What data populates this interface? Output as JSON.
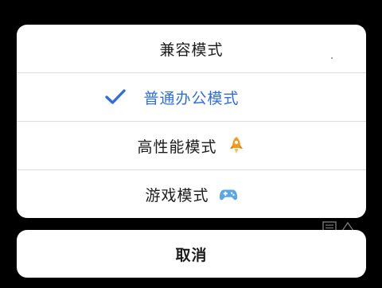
{
  "dialog": {
    "options": [
      {
        "label": "兼容模式",
        "selected": false,
        "icon": ""
      },
      {
        "label": "普通办公模式",
        "selected": true,
        "icon": "checkmark-icon"
      },
      {
        "label": "高性能模式",
        "selected": false,
        "icon": "rocket-icon"
      },
      {
        "label": "游戏模式",
        "selected": false,
        "icon": "gamepad-icon"
      }
    ],
    "cancel_label": "取消"
  },
  "colors": {
    "accent": "#2f6ee0",
    "rocket": "#f39a1c",
    "gamepad": "#5aa7e6",
    "backdrop": "#000000",
    "sheet": "#ffffff"
  }
}
